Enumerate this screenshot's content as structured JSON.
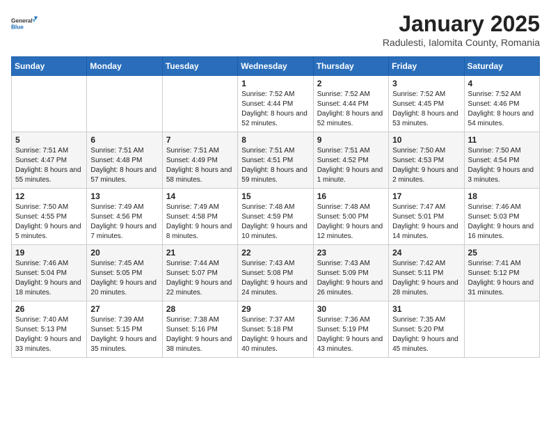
{
  "logo": {
    "general": "General",
    "blue": "Blue"
  },
  "header": {
    "month": "January 2025",
    "location": "Radulesti, Ialomita County, Romania"
  },
  "weekdays": [
    "Sunday",
    "Monday",
    "Tuesday",
    "Wednesday",
    "Thursday",
    "Friday",
    "Saturday"
  ],
  "weeks": [
    [
      {
        "day": null,
        "info": null
      },
      {
        "day": null,
        "info": null
      },
      {
        "day": null,
        "info": null
      },
      {
        "day": "1",
        "info": "Sunrise: 7:52 AM\nSunset: 4:44 PM\nDaylight: 8 hours and 52 minutes."
      },
      {
        "day": "2",
        "info": "Sunrise: 7:52 AM\nSunset: 4:44 PM\nDaylight: 8 hours and 52 minutes."
      },
      {
        "day": "3",
        "info": "Sunrise: 7:52 AM\nSunset: 4:45 PM\nDaylight: 8 hours and 53 minutes."
      },
      {
        "day": "4",
        "info": "Sunrise: 7:52 AM\nSunset: 4:46 PM\nDaylight: 8 hours and 54 minutes."
      }
    ],
    [
      {
        "day": "5",
        "info": "Sunrise: 7:51 AM\nSunset: 4:47 PM\nDaylight: 8 hours and 55 minutes."
      },
      {
        "day": "6",
        "info": "Sunrise: 7:51 AM\nSunset: 4:48 PM\nDaylight: 8 hours and 57 minutes."
      },
      {
        "day": "7",
        "info": "Sunrise: 7:51 AM\nSunset: 4:49 PM\nDaylight: 8 hours and 58 minutes."
      },
      {
        "day": "8",
        "info": "Sunrise: 7:51 AM\nSunset: 4:51 PM\nDaylight: 8 hours and 59 minutes."
      },
      {
        "day": "9",
        "info": "Sunrise: 7:51 AM\nSunset: 4:52 PM\nDaylight: 9 hours and 1 minute."
      },
      {
        "day": "10",
        "info": "Sunrise: 7:50 AM\nSunset: 4:53 PM\nDaylight: 9 hours and 2 minutes."
      },
      {
        "day": "11",
        "info": "Sunrise: 7:50 AM\nSunset: 4:54 PM\nDaylight: 9 hours and 3 minutes."
      }
    ],
    [
      {
        "day": "12",
        "info": "Sunrise: 7:50 AM\nSunset: 4:55 PM\nDaylight: 9 hours and 5 minutes."
      },
      {
        "day": "13",
        "info": "Sunrise: 7:49 AM\nSunset: 4:56 PM\nDaylight: 9 hours and 7 minutes."
      },
      {
        "day": "14",
        "info": "Sunrise: 7:49 AM\nSunset: 4:58 PM\nDaylight: 9 hours and 8 minutes."
      },
      {
        "day": "15",
        "info": "Sunrise: 7:48 AM\nSunset: 4:59 PM\nDaylight: 9 hours and 10 minutes."
      },
      {
        "day": "16",
        "info": "Sunrise: 7:48 AM\nSunset: 5:00 PM\nDaylight: 9 hours and 12 minutes."
      },
      {
        "day": "17",
        "info": "Sunrise: 7:47 AM\nSunset: 5:01 PM\nDaylight: 9 hours and 14 minutes."
      },
      {
        "day": "18",
        "info": "Sunrise: 7:46 AM\nSunset: 5:03 PM\nDaylight: 9 hours and 16 minutes."
      }
    ],
    [
      {
        "day": "19",
        "info": "Sunrise: 7:46 AM\nSunset: 5:04 PM\nDaylight: 9 hours and 18 minutes."
      },
      {
        "day": "20",
        "info": "Sunrise: 7:45 AM\nSunset: 5:05 PM\nDaylight: 9 hours and 20 minutes."
      },
      {
        "day": "21",
        "info": "Sunrise: 7:44 AM\nSunset: 5:07 PM\nDaylight: 9 hours and 22 minutes."
      },
      {
        "day": "22",
        "info": "Sunrise: 7:43 AM\nSunset: 5:08 PM\nDaylight: 9 hours and 24 minutes."
      },
      {
        "day": "23",
        "info": "Sunrise: 7:43 AM\nSunset: 5:09 PM\nDaylight: 9 hours and 26 minutes."
      },
      {
        "day": "24",
        "info": "Sunrise: 7:42 AM\nSunset: 5:11 PM\nDaylight: 9 hours and 28 minutes."
      },
      {
        "day": "25",
        "info": "Sunrise: 7:41 AM\nSunset: 5:12 PM\nDaylight: 9 hours and 31 minutes."
      }
    ],
    [
      {
        "day": "26",
        "info": "Sunrise: 7:40 AM\nSunset: 5:13 PM\nDaylight: 9 hours and 33 minutes."
      },
      {
        "day": "27",
        "info": "Sunrise: 7:39 AM\nSunset: 5:15 PM\nDaylight: 9 hours and 35 minutes."
      },
      {
        "day": "28",
        "info": "Sunrise: 7:38 AM\nSunset: 5:16 PM\nDaylight: 9 hours and 38 minutes."
      },
      {
        "day": "29",
        "info": "Sunrise: 7:37 AM\nSunset: 5:18 PM\nDaylight: 9 hours and 40 minutes."
      },
      {
        "day": "30",
        "info": "Sunrise: 7:36 AM\nSunset: 5:19 PM\nDaylight: 9 hours and 43 minutes."
      },
      {
        "day": "31",
        "info": "Sunrise: 7:35 AM\nSunset: 5:20 PM\nDaylight: 9 hours and 45 minutes."
      },
      {
        "day": null,
        "info": null
      }
    ]
  ]
}
